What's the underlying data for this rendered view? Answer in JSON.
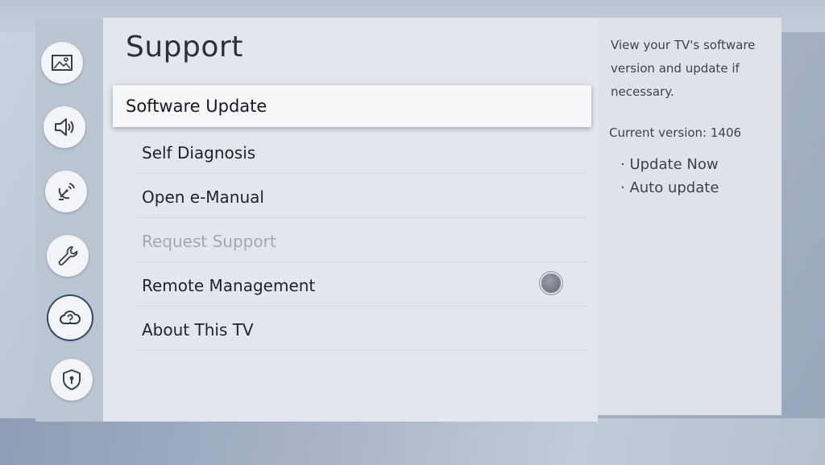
{
  "sidebar": {
    "icons": [
      {
        "name": "picture-icon"
      },
      {
        "name": "sound-icon"
      },
      {
        "name": "broadcasting-icon"
      },
      {
        "name": "general-settings-icon"
      },
      {
        "name": "support-icon"
      },
      {
        "name": "privacy-icon"
      }
    ]
  },
  "page": {
    "title": "Support"
  },
  "menu": {
    "items": [
      {
        "label": "Software Update",
        "state": "selected"
      },
      {
        "label": "Self Diagnosis",
        "state": "normal"
      },
      {
        "label": "Open e-Manual",
        "state": "normal"
      },
      {
        "label": "Request Support",
        "state": "disabled"
      },
      {
        "label": "Remote Management",
        "state": "normal"
      },
      {
        "label": "About This TV",
        "state": "normal"
      }
    ]
  },
  "info": {
    "description": "View your TV's software version and update if necessary.",
    "version": "Current version: 1406",
    "options": [
      "Update Now",
      "Auto update"
    ]
  },
  "colors": {
    "selected_bg": "#f6f7f9",
    "panel_bg": "#e3e6ec",
    "disabled_text": "#a3a8b1"
  }
}
